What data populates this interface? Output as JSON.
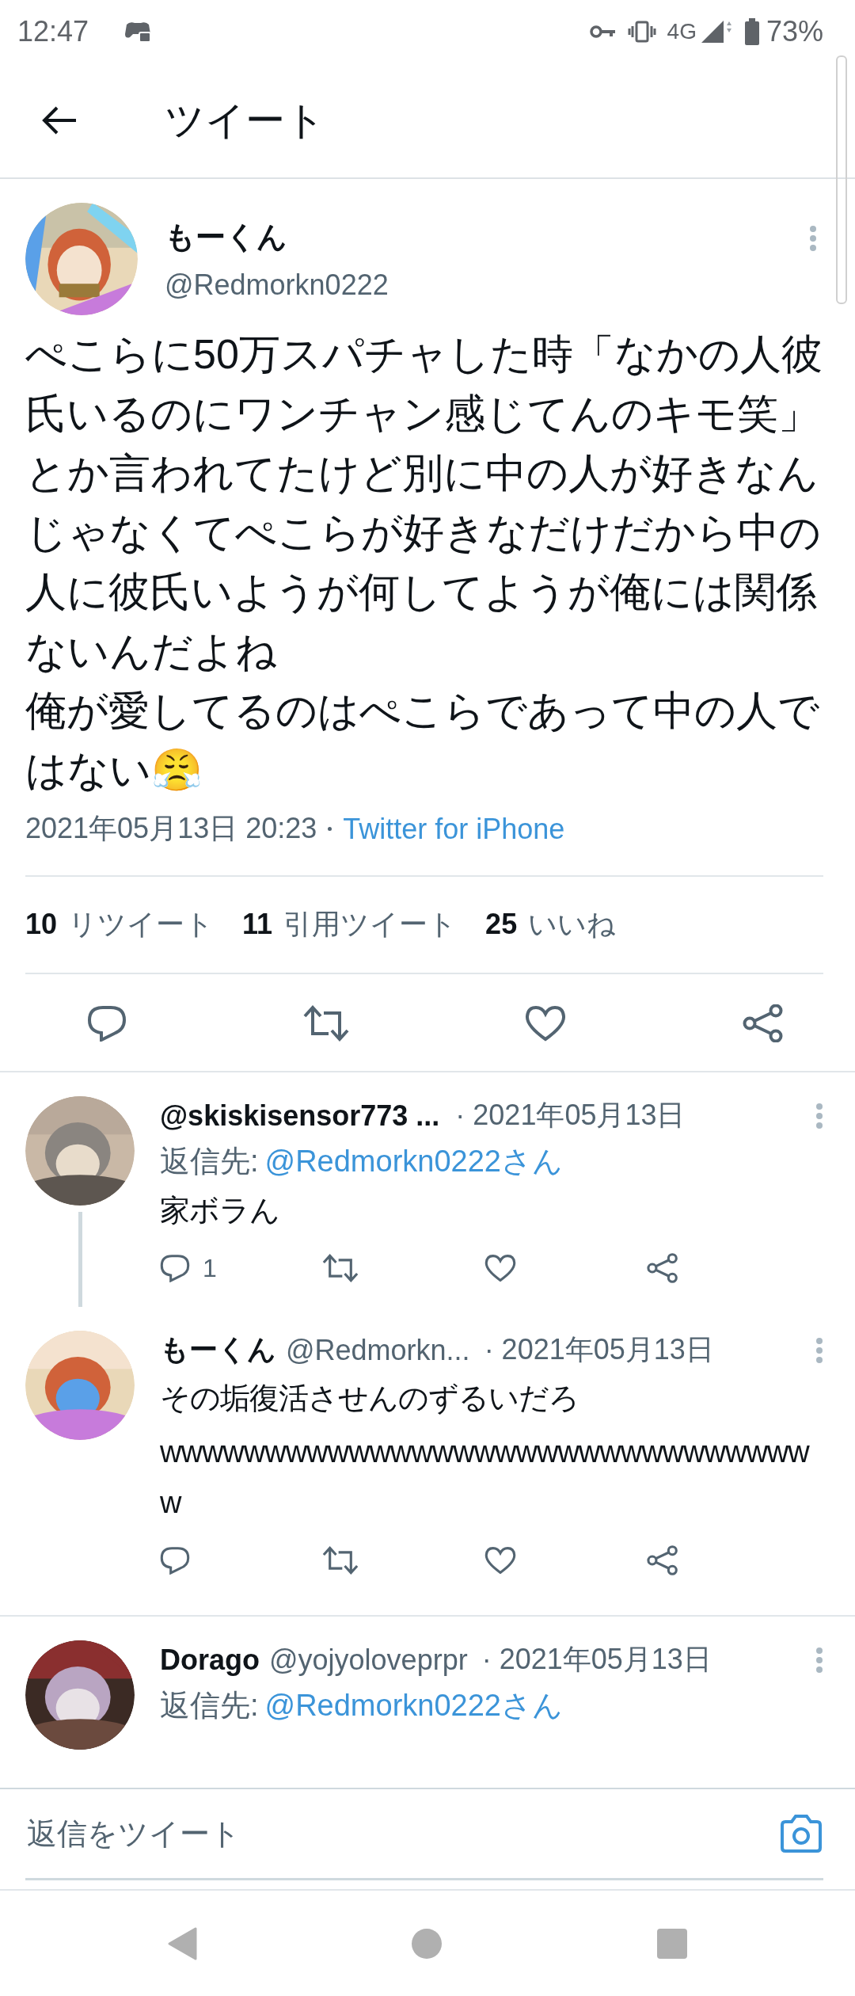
{
  "status_bar": {
    "time": "12:47",
    "network": "4G",
    "battery": "73%"
  },
  "header": {
    "title": "ツイート"
  },
  "tweet": {
    "avatar": {
      "kind": "picture"
    },
    "name": "もーくん",
    "handle": "@Redmorkn0222",
    "paragraphs": [
      "ぺこらに50万スパチャした時「なかの人彼氏いるのにワンチャン感じてんのキモ笑」とか言われてたけど別に中の人が好きなんじゃなくてぺこらが好きなだけだから中の人に彼氏いようが何してようが俺には関係ないんだよね",
      "俺が愛してるのはぺこらであって中の人ではない😤"
    ],
    "timestamp": "2021年05月13日 20:23",
    "source": "Twitter for iPhone",
    "stats": [
      {
        "count": "10",
        "label": "リツイート"
      },
      {
        "count": "11",
        "label": "引用ツイート"
      },
      {
        "count": "25",
        "label": "いいね"
      }
    ]
  },
  "replies": [
    {
      "avatar": {
        "kind": "picture"
      },
      "name": "@skiskisensor773 ...",
      "date": "· 2021年05月13日",
      "reply_to_label": "返信先:",
      "reply_to": "@Redmorkn0222さん",
      "paragraphs": [
        "家ボラん"
      ],
      "reply_count": "1",
      "thread_below": true
    },
    {
      "avatar": {
        "kind": "picture"
      },
      "name": "もーくん",
      "handle": "@Redmorkn...",
      "date": "· 2021年05月13日",
      "paragraphs": [
        "その垢復活させんのずるいだろ",
        "wwwwwwwwwwwwwwwwwwwwwwwwwwwwwwww"
      ],
      "thread_below": false
    },
    {
      "avatar": {
        "kind": "picture"
      },
      "name": "Dorago",
      "handle": "@yojyoloveprpr",
      "date": "· 2021年05月13日",
      "reply_to_label": "返信先:",
      "reply_to": "@Redmorkn0222さん",
      "thread_below": false
    }
  ],
  "reply_box": {
    "placeholder": "返信をツイート"
  }
}
